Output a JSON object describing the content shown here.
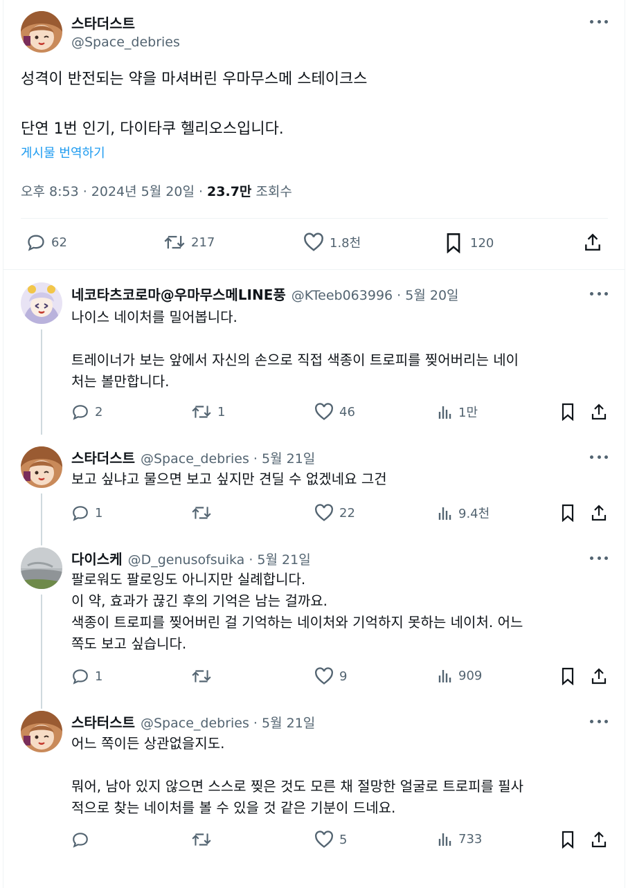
{
  "main_tweet": {
    "author_name": "스타더스트",
    "author_handle": "@Space_debries",
    "text_line1": "성격이 반전되는 약을 마셔버린 우마무스메 스테이크스",
    "text_line2": "단연 1번 인기, 다이타쿠 헬리오스입니다.",
    "translate_label": "게시물 번역하기",
    "time": "오후 8:53 · 2024년 5월 20일 · ",
    "views_count": "23.7만",
    "views_label": " 조회수",
    "replies": "62",
    "retweets": "217",
    "likes": "1.8천",
    "bookmarks": "120"
  },
  "replies": [
    {
      "author_name": "네코타츠코로마@우마무스메LINE풍",
      "author_handle": "@KTeeb063996 · 5월 20일",
      "lines": [
        "나이스 네이처를 밀어봅니다.",
        "",
        "트레이너가 보는 앞에서 자신의 손으로 직접 색종이 트로피를 찢어버리는 네이",
        "처는 볼만합니다."
      ],
      "replies": "2",
      "retweets": "1",
      "likes": "46",
      "views": "1만"
    },
    {
      "author_name": "스타더스트",
      "author_handle": "@Space_debries · 5월 21일",
      "lines": [
        "보고 싶냐고 물으면 보고 싶지만 견딜 수 없겠네요 그건"
      ],
      "replies": "1",
      "retweets": "",
      "likes": "22",
      "views": "9.4천"
    },
    {
      "author_name": "다이스케",
      "author_handle": "@D_genusofsuika · 5월 21일",
      "lines": [
        "팔로워도 팔로잉도 아니지만 실례합니다.",
        "이 약, 효과가 끊긴 후의 기억은 남는 걸까요.",
        "색종이 트로피를 찢어버린 걸 기억하는 네이처와 기억하지 못하는 네이처. 어느",
        "쪽도 보고 싶습니다."
      ],
      "replies": "1",
      "retweets": "",
      "likes": "9",
      "views": "909"
    },
    {
      "author_name": "스타터스트",
      "author_handle": "@Space_debries · 5월 21일",
      "lines": [
        "어느 쪽이든 상관없을지도.",
        "",
        "뭐어, 남아 있지 않으면 스스로 찢은 것도 모른 채 절망한 얼굴로 트로피를 필사",
        "적으로 찾는 네이처를 볼 수 있을 것 같은 기분이 드네요."
      ],
      "replies": "",
      "retweets": "",
      "likes": "5",
      "views": "733"
    }
  ],
  "icons": {
    "reply": "reply-icon",
    "retweet": "retweet-icon",
    "like": "heart-icon",
    "views": "views-icon",
    "bookmark": "bookmark-icon",
    "share": "share-icon",
    "more": "more-icon"
  },
  "colors": {
    "text": "#0f1419",
    "secondary": "#536471",
    "link": "#1d9bf0",
    "border": "#eff3f4"
  }
}
